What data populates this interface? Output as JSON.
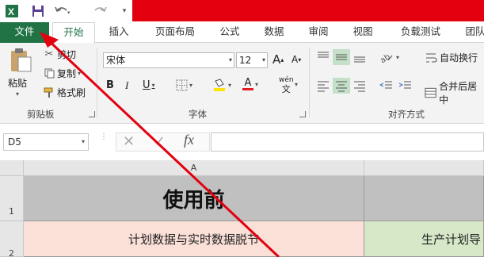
{
  "quick_access": {
    "app_icon": "excel-icon",
    "save_icon": "save-icon",
    "undo_icon": "undo-icon",
    "redo_icon": "redo-icon",
    "customize_icon": "customize-quick-access-icon"
  },
  "tabs": [
    {
      "label": "文件"
    },
    {
      "label": "开始"
    },
    {
      "label": "插入"
    },
    {
      "label": "页面布局"
    },
    {
      "label": "公式"
    },
    {
      "label": "数据"
    },
    {
      "label": "审阅"
    },
    {
      "label": "视图"
    },
    {
      "label": "负载测试"
    },
    {
      "label": "团队"
    }
  ],
  "clipboard": {
    "paste_label": "粘贴",
    "cut_label": "剪切",
    "copy_label": "复制",
    "format_painter_label": "格式刷",
    "group_label": "剪贴板"
  },
  "font": {
    "font_name": "宋体",
    "font_size": "12",
    "increase_label": "A",
    "decrease_label": "A",
    "bold_label": "B",
    "italic_label": "I",
    "underline_label": "U",
    "font_color_label": "A",
    "phonetic_top": "wén",
    "phonetic_bottom": "文",
    "group_label": "字体",
    "font_color": "#e31b23",
    "fill_color": "#ffe600"
  },
  "alignment": {
    "wrap_text_label": "自动换行",
    "merge_label": "合并后居中",
    "group_label": "对齐方式"
  },
  "formula_bar": {
    "name_box": "D5",
    "fx_label": "fx"
  },
  "sheet": {
    "column_header": "A",
    "row_headers": [
      "1",
      "2"
    ],
    "a1": "使用前",
    "a2": "计划数据与实时数据脱节",
    "b2": "生产计划导",
    "colors": {
      "header_fill": "#c0c0c0",
      "a2_fill": "#fbe0d8",
      "b2_fill": "#d6e8c8"
    }
  },
  "annotation": {
    "arrow_color": "#e3000f"
  }
}
